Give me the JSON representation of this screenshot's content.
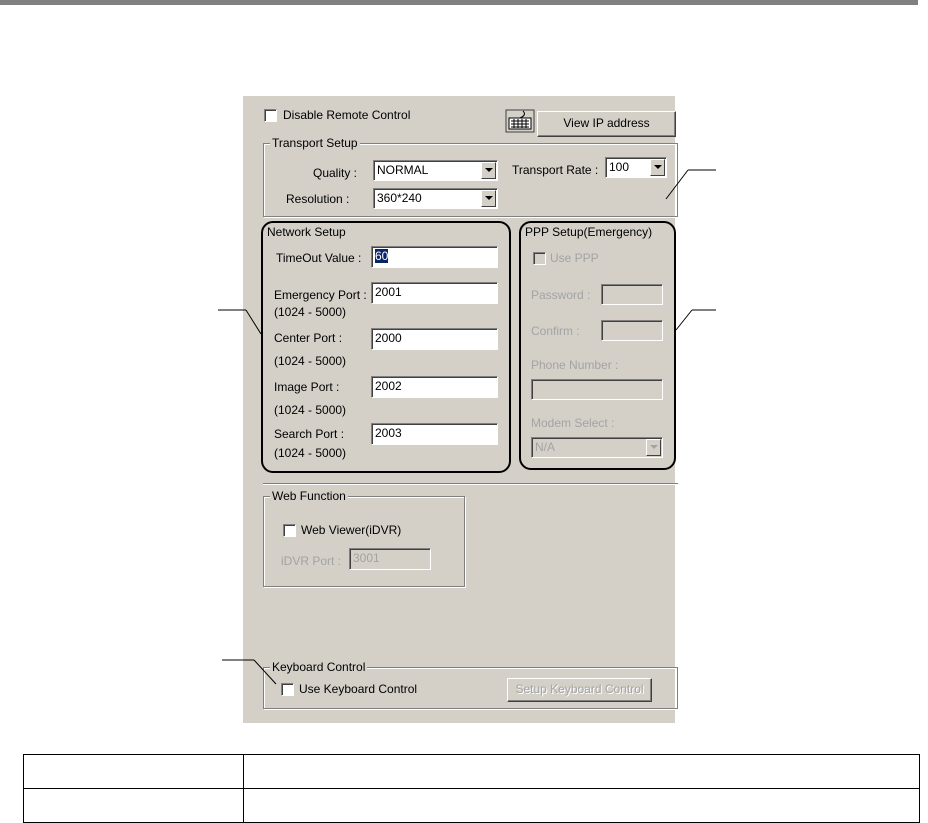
{
  "remote": {
    "disable_label": "Disable Remote Control",
    "view_ip_label": "View IP address",
    "keyboard_icon": "keyboard-icon"
  },
  "transport": {
    "title": "Transport Setup",
    "quality_label": "Quality :",
    "quality_value": "NORMAL",
    "resolution_label": "Resolution :",
    "resolution_value": "360*240",
    "rate_label": "Transport Rate :",
    "rate_value": "100"
  },
  "network": {
    "title": "Network Setup",
    "timeout_label": "TimeOut Value :",
    "timeout_value": "60",
    "emergency_label": "Emergency Port :",
    "emergency_value": "2001",
    "center_label": "Center Port :",
    "center_value": "2000",
    "image_label": "Image Port :",
    "image_value": "2002",
    "search_label": "Search Port :",
    "search_value": "2003",
    "range_label": "(1024 - 5000)"
  },
  "ppp": {
    "title": "PPP Setup(Emergency)",
    "use_label": "Use PPP",
    "password_label": "Password :",
    "confirm_label": "Confirm :",
    "phone_label": "Phone Number :",
    "modem_label": "Modem Select :",
    "modem_value": "N/A"
  },
  "web": {
    "title": "Web Function",
    "viewer_label": "Web Viewer(iDVR)",
    "port_label": "iDVR Port :",
    "port_value": "3001"
  },
  "keyboard": {
    "title": "Keyboard Control",
    "use_label": "Use Keyboard Control",
    "setup_label": "Setup Keyboard Control"
  },
  "table": {
    "rows": [
      [
        "",
        ""
      ],
      [
        "",
        ""
      ]
    ]
  }
}
